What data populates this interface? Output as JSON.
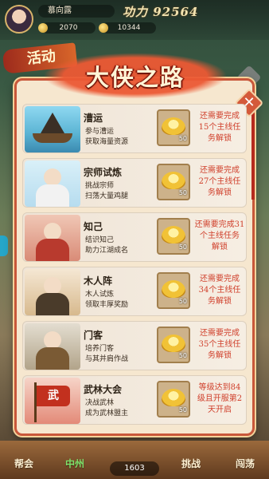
{
  "top_bar": {
    "player_name": "慕向露",
    "power_label": "功力 92564",
    "gold": "2070",
    "silver": "10344"
  },
  "activity_banner": "活动",
  "modal": {
    "title": "大侠之路",
    "close_icon": "✕",
    "rows": [
      {
        "name": "漕运",
        "desc_line1": "参与漕运",
        "desc_line2": "获取海量资源",
        "reward_count": "50",
        "status": [
          "还需要完成",
          "15个主线任",
          "务解锁"
        ],
        "art": "boat"
      },
      {
        "name": "宗师试炼",
        "desc_line1": "挑战宗师",
        "desc_line2": "扫荡大量鸡腿",
        "reward_count": "50",
        "status": [
          "还需要完成",
          "27个主线任",
          "务解锁"
        ],
        "art": "master"
      },
      {
        "name": "知己",
        "desc_line1": "结识知己",
        "desc_line2": "助力江湖成名",
        "reward_count": "50",
        "status": [
          "还需要完成31",
          "个主线任务",
          "解锁"
        ],
        "art": "lady"
      },
      {
        "name": "木人阵",
        "desc_line1": "木人试炼",
        "desc_line2": "领取丰厚奖励",
        "reward_count": "50",
        "status": [
          "还需要完成",
          "34个主线任",
          "务解锁"
        ],
        "art": "dummy"
      },
      {
        "name": "门客",
        "desc_line1": "培养门客",
        "desc_line2": "与其并肩作战",
        "reward_count": "50",
        "status": [
          "还需要完成",
          "35个主线任",
          "务解锁"
        ],
        "art": "guest"
      },
      {
        "name": "武林大会",
        "desc_line1": "决战武林",
        "desc_line2": "成为武林盟主",
        "reward_count": "50",
        "status": [
          "等级达到84",
          "级且开服第2",
          "天开启"
        ],
        "art": "flag",
        "flag_text": "武"
      }
    ]
  },
  "bottom_nav": {
    "guild": "帮会",
    "city": "中州",
    "counter": "1603",
    "fight": "挑战",
    "roam": "闯荡"
  }
}
